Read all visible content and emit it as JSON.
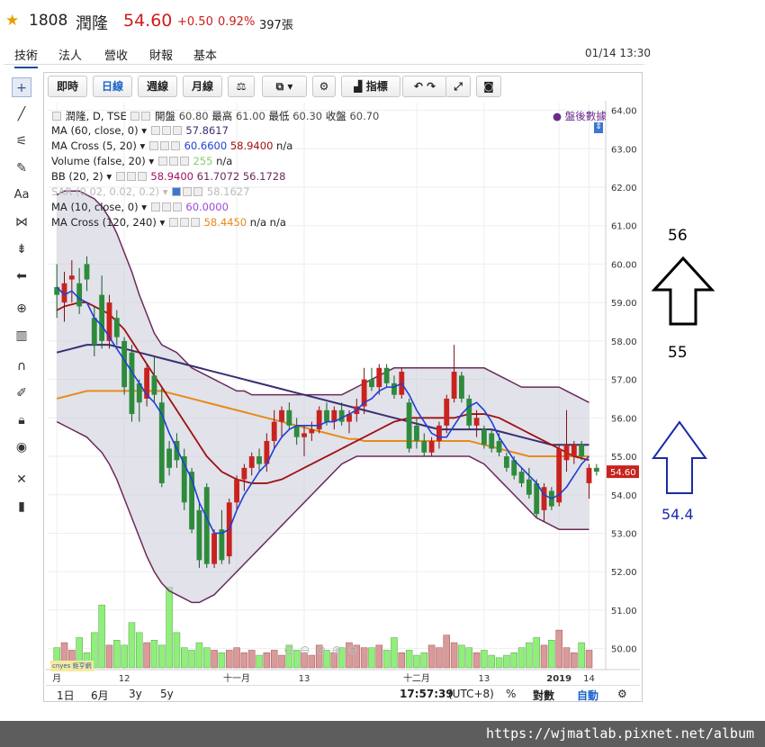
{
  "header": {
    "code": "1808",
    "name": "潤隆",
    "price": "54.60",
    "change": "+0.50",
    "percent": "0.92%",
    "volume": "397張"
  },
  "tabs": [
    "技術",
    "法人",
    "營收",
    "財報",
    "基本"
  ],
  "datetime": "01/14 13:30",
  "toolbar": {
    "realtime": "即時",
    "daily": "日線",
    "weekly": "週線",
    "monthly": "月線",
    "indicators": "指標"
  },
  "legend": {
    "main_name": "潤隆, D, TSE",
    "open_label": "開盤",
    "open": "60.80",
    "high_label": "最高",
    "high": "61.00",
    "low_label": "最低",
    "low": "60.30",
    "close_label": "收盤",
    "close": "60.70",
    "after_hours": "盤後數據",
    "ma60_name": "MA (60, close, 0)",
    "ma60_val": "57.8617",
    "macross_name": "MA Cross (5, 20)",
    "macross_v1": "60.6600",
    "macross_v2": "58.9400",
    "macross_v3": "n/a",
    "volume_name": "Volume (false, 20)",
    "volume_v1": "255",
    "volume_v2": "n/a",
    "bb_name": "BB (20, 2)",
    "bb_v1": "58.9400",
    "bb_v2": "61.7072",
    "bb_v3": "56.1728",
    "sar_name": "SAR (0.02, 0.02, 0.2)",
    "sar_val": "58.1627",
    "ma10_name": "MA (10, close, 0)",
    "ma10_val": "60.0000",
    "macross2_name": "MA Cross (120, 240)",
    "macross2_v1": "58.4450",
    "macross2_v2": "n/a",
    "macross2_v3": "n/a"
  },
  "price_axis": [
    "64.00",
    "63.00",
    "62.00",
    "61.00",
    "60.00",
    "59.00",
    "58.00",
    "57.00",
    "56.00",
    "55.00",
    "54.00",
    "53.00",
    "52.00",
    "51.00",
    "50.00"
  ],
  "last_price_tag": "54.60",
  "time_axis": [
    "月",
    "12",
    "十一月",
    "13",
    "十二月",
    "13",
    "2019",
    "14"
  ],
  "bottom_bar": {
    "r1": "1日",
    "r2": "6月",
    "r3": "3y",
    "r4": "5y",
    "clock": "17:57:39",
    "tz": "(UTC+8)",
    "pct": "%",
    "log": "對數",
    "auto": "自動"
  },
  "logo_text": "cnyes 鉅亨網",
  "annotations": {
    "target_up": "56",
    "mid": "55",
    "target_low": "54.4"
  },
  "watermark": "https://wjmatlab.pixnet.net/album",
  "colors": {
    "up": "#c8231e",
    "down": "#2e8b3c",
    "ma5": "#1e3fd6",
    "ma20": "#a01010",
    "ma60": "#3a2f72",
    "ma120": "#e88a1a",
    "bb": "#6a2a5a",
    "ma10": "#9a4ad6"
  },
  "chart_data": {
    "type": "candlestick",
    "symbol": "1808",
    "ylim": [
      49.5,
      64.2
    ],
    "candles": [
      {
        "o": 59.4,
        "h": 60.0,
        "l": 58.6,
        "c": 59.2
      },
      {
        "o": 59.0,
        "h": 59.8,
        "l": 58.5,
        "c": 59.5
      },
      {
        "o": 59.6,
        "h": 60.1,
        "l": 59.0,
        "c": 59.7
      },
      {
        "o": 59.5,
        "h": 59.9,
        "l": 58.7,
        "c": 58.9
      },
      {
        "o": 60.0,
        "h": 60.2,
        "l": 59.3,
        "c": 59.6
      },
      {
        "o": 58.6,
        "h": 58.9,
        "l": 57.6,
        "c": 57.9
      },
      {
        "o": 59.2,
        "h": 59.7,
        "l": 57.8,
        "c": 58.0
      },
      {
        "o": 58.0,
        "h": 59.2,
        "l": 57.8,
        "c": 59.0
      },
      {
        "o": 58.6,
        "h": 58.8,
        "l": 57.9,
        "c": 58.1
      },
      {
        "o": 58.0,
        "h": 58.1,
        "l": 56.6,
        "c": 56.8
      },
      {
        "o": 57.7,
        "h": 57.9,
        "l": 55.9,
        "c": 56.1
      },
      {
        "o": 56.9,
        "h": 57.0,
        "l": 55.9,
        "c": 56.4
      },
      {
        "o": 56.5,
        "h": 57.4,
        "l": 56.3,
        "c": 57.3
      },
      {
        "o": 57.1,
        "h": 57.6,
        "l": 56.4,
        "c": 56.6
      },
      {
        "o": 56.4,
        "h": 56.8,
        "l": 54.2,
        "c": 54.3
      },
      {
        "o": 55.2,
        "h": 55.4,
        "l": 54.5,
        "c": 54.7
      },
      {
        "o": 55.4,
        "h": 55.6,
        "l": 54.7,
        "c": 54.9
      },
      {
        "o": 55.0,
        "h": 55.2,
        "l": 53.6,
        "c": 53.8
      },
      {
        "o": 54.6,
        "h": 54.7,
        "l": 53.0,
        "c": 53.1
      },
      {
        "o": 53.6,
        "h": 53.8,
        "l": 52.1,
        "c": 52.3
      },
      {
        "o": 54.2,
        "h": 54.3,
        "l": 52.1,
        "c": 52.2
      },
      {
        "o": 52.2,
        "h": 53.1,
        "l": 52.1,
        "c": 53.0
      },
      {
        "o": 53.1,
        "h": 53.6,
        "l": 52.2,
        "c": 52.3
      },
      {
        "o": 52.4,
        "h": 53.9,
        "l": 52.2,
        "c": 53.8
      },
      {
        "o": 53.8,
        "h": 54.5,
        "l": 53.6,
        "c": 54.4
      },
      {
        "o": 54.4,
        "h": 54.8,
        "l": 54.1,
        "c": 54.7
      },
      {
        "o": 54.7,
        "h": 55.1,
        "l": 54.5,
        "c": 55.0
      },
      {
        "o": 55.0,
        "h": 55.2,
        "l": 54.6,
        "c": 54.8
      },
      {
        "o": 54.8,
        "h": 55.6,
        "l": 54.6,
        "c": 55.4
      },
      {
        "o": 55.4,
        "h": 56.2,
        "l": 55.2,
        "c": 55.9
      },
      {
        "o": 55.9,
        "h": 56.3,
        "l": 55.5,
        "c": 56.2
      },
      {
        "o": 56.2,
        "h": 56.4,
        "l": 55.7,
        "c": 55.8
      },
      {
        "o": 55.8,
        "h": 56.0,
        "l": 55.3,
        "c": 55.5
      },
      {
        "o": 55.5,
        "h": 55.8,
        "l": 55.0,
        "c": 55.6
      },
      {
        "o": 55.6,
        "h": 55.9,
        "l": 55.4,
        "c": 55.7
      },
      {
        "o": 55.7,
        "h": 56.3,
        "l": 55.6,
        "c": 56.2
      },
      {
        "o": 56.2,
        "h": 56.4,
        "l": 55.8,
        "c": 55.9
      },
      {
        "o": 55.9,
        "h": 56.3,
        "l": 55.7,
        "c": 56.2
      },
      {
        "o": 56.2,
        "h": 56.4,
        "l": 55.8,
        "c": 55.9
      },
      {
        "o": 55.9,
        "h": 56.2,
        "l": 55.6,
        "c": 56.1
      },
      {
        "o": 56.1,
        "h": 56.5,
        "l": 55.9,
        "c": 56.3
      },
      {
        "o": 56.3,
        "h": 57.3,
        "l": 56.1,
        "c": 57.0
      },
      {
        "o": 57.0,
        "h": 57.3,
        "l": 56.7,
        "c": 56.8
      },
      {
        "o": 56.8,
        "h": 57.4,
        "l": 56.6,
        "c": 57.3
      },
      {
        "o": 57.3,
        "h": 57.4,
        "l": 56.8,
        "c": 56.9
      },
      {
        "o": 56.9,
        "h": 57.1,
        "l": 56.5,
        "c": 56.6
      },
      {
        "o": 56.6,
        "h": 57.3,
        "l": 56.5,
        "c": 57.2
      },
      {
        "o": 56.4,
        "h": 56.5,
        "l": 55.1,
        "c": 55.2
      },
      {
        "o": 55.8,
        "h": 56.0,
        "l": 55.2,
        "c": 55.4
      },
      {
        "o": 55.4,
        "h": 55.6,
        "l": 55.0,
        "c": 55.1
      },
      {
        "o": 55.1,
        "h": 55.5,
        "l": 55.0,
        "c": 55.4
      },
      {
        "o": 55.4,
        "h": 55.9,
        "l": 55.2,
        "c": 55.8
      },
      {
        "o": 55.8,
        "h": 56.6,
        "l": 55.6,
        "c": 56.5
      },
      {
        "o": 56.5,
        "h": 57.9,
        "l": 56.4,
        "c": 57.2
      },
      {
        "o": 57.1,
        "h": 57.2,
        "l": 56.4,
        "c": 56.5
      },
      {
        "o": 56.5,
        "h": 56.6,
        "l": 55.7,
        "c": 55.8
      },
      {
        "o": 55.8,
        "h": 56.2,
        "l": 55.5,
        "c": 56.0
      },
      {
        "o": 55.7,
        "h": 55.8,
        "l": 55.2,
        "c": 55.3
      },
      {
        "o": 55.6,
        "h": 55.7,
        "l": 55.1,
        "c": 55.2
      },
      {
        "o": 55.4,
        "h": 55.6,
        "l": 55.0,
        "c": 55.1
      },
      {
        "o": 55.0,
        "h": 55.1,
        "l": 54.6,
        "c": 54.7
      },
      {
        "o": 54.9,
        "h": 55.0,
        "l": 54.4,
        "c": 54.5
      },
      {
        "o": 54.6,
        "h": 54.7,
        "l": 54.2,
        "c": 54.3
      },
      {
        "o": 54.4,
        "h": 54.7,
        "l": 53.9,
        "c": 54.0
      },
      {
        "o": 54.3,
        "h": 54.4,
        "l": 53.4,
        "c": 53.5
      },
      {
        "o": 53.6,
        "h": 54.3,
        "l": 53.3,
        "c": 54.2
      },
      {
        "o": 54.1,
        "h": 54.2,
        "l": 53.6,
        "c": 53.7
      },
      {
        "o": 53.8,
        "h": 55.3,
        "l": 53.7,
        "c": 55.2
      },
      {
        "o": 54.9,
        "h": 56.2,
        "l": 54.6,
        "c": 55.3
      },
      {
        "o": 55.0,
        "h": 55.4,
        "l": 54.8,
        "c": 55.3
      },
      {
        "o": 55.3,
        "h": 55.4,
        "l": 54.9,
        "c": 55.0
      },
      {
        "o": 54.3,
        "h": 54.8,
        "l": 53.9,
        "c": 54.7
      },
      {
        "o": 54.7,
        "h": 54.8,
        "l": 54.5,
        "c": 54.6
      }
    ],
    "volume": [
      8,
      10,
      7,
      12,
      6,
      14,
      25,
      9,
      11,
      9,
      18,
      14,
      10,
      11,
      9,
      32,
      14,
      8,
      7,
      10,
      8,
      7,
      6,
      7,
      8,
      6,
      7,
      5,
      6,
      7,
      5,
      9,
      7,
      6,
      5,
      9,
      7,
      6,
      8,
      10,
      9,
      8,
      8,
      9,
      7,
      12,
      6,
      7,
      5,
      6,
      9,
      8,
      13,
      10,
      9,
      8,
      6,
      7,
      5,
      4,
      5,
      6,
      8,
      10,
      12,
      9,
      11,
      15,
      8,
      6,
      10,
      7
    ],
    "ma5": [
      59.4,
      59.2,
      59.3,
      59.1,
      59.0,
      58.6,
      58.4,
      58.1,
      57.8,
      57.5,
      57.2,
      56.9,
      56.6,
      56.4,
      56.1,
      55.6,
      55.2,
      54.8,
      54.4,
      53.8,
      53.4,
      53.0,
      53.0,
      53.1,
      53.6,
      54.0,
      54.3,
      54.6,
      54.8,
      55.2,
      55.5,
      55.7,
      55.8,
      55.8,
      55.8,
      55.8,
      55.9,
      55.9,
      56.0,
      56.1,
      56.2,
      56.4,
      56.5,
      56.7,
      56.8,
      56.8,
      56.9,
      56.6,
      56.2,
      55.9,
      55.6,
      55.5,
      55.5,
      55.8,
      56.1,
      56.3,
      56.4,
      56.2,
      55.9,
      55.5,
      55.2,
      54.9,
      54.7,
      54.5,
      54.3,
      54.0,
      53.9,
      54.0,
      54.2,
      54.5,
      54.8,
      55.0
    ],
    "ma20": [
      58.8,
      58.9,
      58.95,
      59.0,
      59.0,
      58.9,
      58.8,
      58.7,
      58.5,
      58.3,
      58.0,
      57.7,
      57.4,
      57.1,
      56.8,
      56.5,
      56.2,
      55.9,
      55.6,
      55.3,
      55.0,
      54.8,
      54.6,
      54.5,
      54.4,
      54.35,
      54.3,
      54.3,
      54.3,
      54.35,
      54.4,
      54.5,
      54.6,
      54.7,
      54.8,
      54.9,
      55.0,
      55.1,
      55.2,
      55.3,
      55.4,
      55.5,
      55.6,
      55.7,
      55.8,
      55.9,
      55.95,
      56.0,
      56.0,
      56.0,
      56.0,
      56.0,
      56.0,
      56.0,
      56.05,
      56.1,
      56.1,
      56.1,
      56.05,
      56.0,
      55.9,
      55.8,
      55.7,
      55.6,
      55.5,
      55.4,
      55.3,
      55.2,
      55.1,
      55.0,
      54.95,
      54.9
    ],
    "ma60": [
      57.7,
      57.75,
      57.8,
      57.85,
      57.9,
      57.9,
      57.9,
      57.9,
      57.85,
      57.8,
      57.75,
      57.7,
      57.65,
      57.6,
      57.55,
      57.5,
      57.45,
      57.4,
      57.35,
      57.3,
      57.25,
      57.2,
      57.15,
      57.1,
      57.05,
      57.0,
      56.95,
      56.9,
      56.85,
      56.8,
      56.75,
      56.7,
      56.65,
      56.6,
      56.55,
      56.5,
      56.45,
      56.4,
      56.35,
      56.3,
      56.25,
      56.2,
      56.15,
      56.1,
      56.05,
      56.0,
      55.95,
      55.9,
      55.85,
      55.8,
      55.75,
      55.7,
      55.7,
      55.7,
      55.7,
      55.7,
      55.7,
      55.7,
      55.7,
      55.65,
      55.6,
      55.55,
      55.5,
      55.45,
      55.4,
      55.35,
      55.3,
      55.3,
      55.3,
      55.3,
      55.3,
      55.3
    ],
    "ma120": [
      56.5,
      56.55,
      56.6,
      56.65,
      56.7,
      56.7,
      56.7,
      56.7,
      56.7,
      56.7,
      56.7,
      56.7,
      56.7,
      56.7,
      56.7,
      56.65,
      56.6,
      56.55,
      56.5,
      56.45,
      56.4,
      56.35,
      56.3,
      56.25,
      56.2,
      56.15,
      56.1,
      56.05,
      56.0,
      55.95,
      55.9,
      55.85,
      55.8,
      55.75,
      55.7,
      55.65,
      55.6,
      55.55,
      55.5,
      55.45,
      55.45,
      55.4,
      55.4,
      55.4,
      55.4,
      55.4,
      55.4,
      55.4,
      55.4,
      55.4,
      55.4,
      55.4,
      55.4,
      55.4,
      55.4,
      55.4,
      55.35,
      55.3,
      55.25,
      55.2,
      55.15,
      55.1,
      55.05,
      55.0,
      55.0,
      55.0,
      55.0,
      55.0,
      55.0,
      55.0,
      55.0,
      55.0
    ],
    "bb_upper": [
      61.8,
      61.9,
      61.9,
      61.9,
      61.8,
      61.7,
      61.5,
      61.2,
      60.8,
      60.3,
      59.8,
      59.2,
      58.7,
      58.2,
      57.9,
      57.8,
      57.7,
      57.5,
      57.3,
      57.2,
      57.1,
      57.0,
      56.9,
      56.8,
      56.7,
      56.7,
      56.6,
      56.6,
      56.6,
      56.6,
      56.6,
      56.6,
      56.6,
      56.6,
      56.6,
      56.6,
      56.6,
      56.6,
      56.6,
      56.7,
      56.8,
      56.9,
      57.0,
      57.1,
      57.2,
      57.3,
      57.3,
      57.3,
      57.3,
      57.3,
      57.3,
      57.3,
      57.3,
      57.3,
      57.3,
      57.3,
      57.3,
      57.3,
      57.2,
      57.1,
      57.0,
      56.9,
      56.8,
      56.8,
      56.8,
      56.8,
      56.8,
      56.8,
      56.7,
      56.6,
      56.5,
      56.4
    ],
    "bb_lower": [
      55.9,
      55.8,
      55.7,
      55.6,
      55.5,
      55.3,
      55.1,
      54.8,
      54.4,
      53.9,
      53.4,
      52.9,
      52.4,
      52.0,
      51.7,
      51.5,
      51.4,
      51.3,
      51.2,
      51.2,
      51.3,
      51.4,
      51.6,
      51.8,
      52.0,
      52.2,
      52.4,
      52.6,
      52.8,
      53.0,
      53.2,
      53.4,
      53.6,
      53.8,
      54.0,
      54.2,
      54.4,
      54.6,
      54.8,
      54.9,
      55.0,
      55.0,
      55.0,
      55.0,
      55.0,
      55.0,
      55.0,
      55.0,
      55.0,
      55.0,
      55.0,
      55.0,
      55.0,
      55.0,
      55.0,
      55.0,
      54.9,
      54.8,
      54.6,
      54.4,
      54.2,
      54.0,
      53.8,
      53.6,
      53.4,
      53.3,
      53.2,
      53.1,
      53.1,
      53.1,
      53.1,
      53.1
    ]
  }
}
